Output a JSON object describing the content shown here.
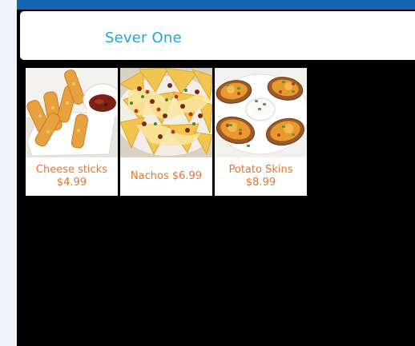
{
  "header": {
    "server_title": "Sever One"
  },
  "menu": {
    "items": [
      {
        "label": "Cheese sticks $4.99",
        "image": "cheese-sticks-photo"
      },
      {
        "label": "Nachos $6.99",
        "image": "nachos-photo"
      },
      {
        "label": "Potato Skins $8.99",
        "image": "potato-skins-photo"
      }
    ]
  },
  "colors": {
    "top_bar": "#1565b3",
    "title_text": "#1ea6dd",
    "item_text": "#e8752a",
    "background": "#000000",
    "side_strip": "#eef1f8"
  }
}
